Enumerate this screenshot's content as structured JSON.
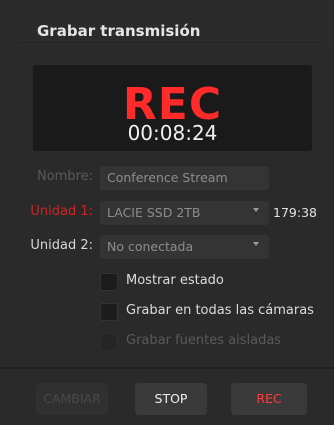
{
  "header": {
    "title": "Grabar transmisión"
  },
  "status": {
    "indicator": "REC",
    "timecode": "00:08:24",
    "indicator_color": "#ff2a2a"
  },
  "form": {
    "name": {
      "label": "Nombre:",
      "value": "Conference Stream"
    },
    "disk1": {
      "label": "Unidad 1:",
      "value": "LACIE SSD 2TB",
      "remaining": "179:38",
      "label_color": "#d42222"
    },
    "disk2": {
      "label": "Unidad 2:",
      "value": "No conectada"
    },
    "options": [
      {
        "label": "Mostrar estado",
        "checked": false,
        "enabled": true
      },
      {
        "label": "Grabar en todas las cámaras",
        "checked": false,
        "enabled": true
      },
      {
        "label": "Grabar fuentes aisladas",
        "checked": false,
        "enabled": false
      }
    ]
  },
  "buttons": {
    "change": "CAMBIAR",
    "stop": "STOP",
    "rec": "REC"
  }
}
